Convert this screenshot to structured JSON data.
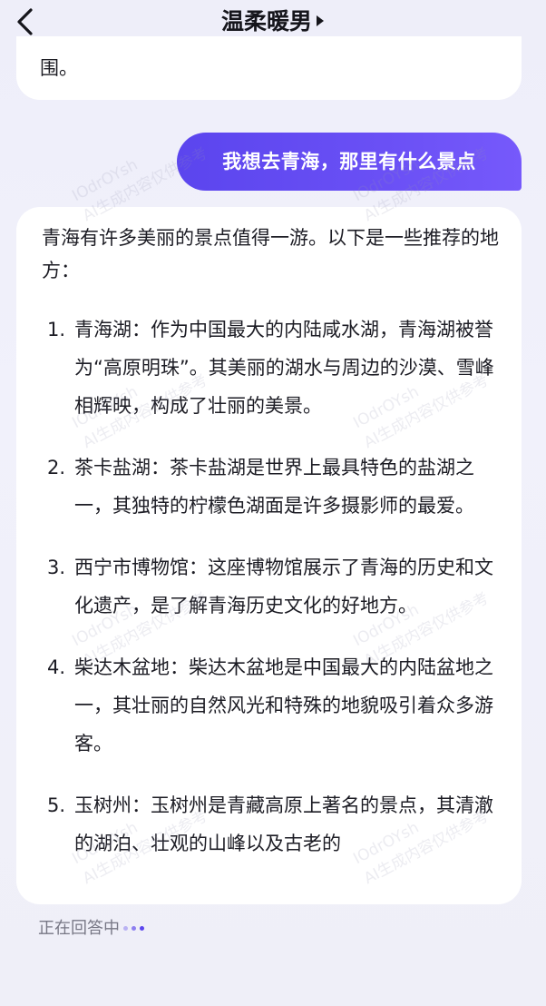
{
  "header": {
    "title": "温柔暖男"
  },
  "messages": {
    "previous_ai_tail": "围。",
    "user_question": "我想去青海，那里有什么景点",
    "ai_answer": {
      "intro": "青海有许多美丽的景点值得一游。以下是一些推荐的地方：",
      "items": [
        {
          "num": "1.",
          "text": "青海湖：作为中国最大的内陆咸水湖，青海湖被誉为“高原明珠”。其美丽的湖水与周边的沙漠、雪峰相辉映，构成了壮丽的美景。"
        },
        {
          "num": "2.",
          "text": "茶卡盐湖：茶卡盐湖是世界上最具特色的盐湖之一，其独特的柠檬色湖面是许多摄影师的最爱。"
        },
        {
          "num": "3.",
          "text": "西宁市博物馆：这座博物馆展示了青海的历史和文化遗产，是了解青海历史文化的好地方。"
        },
        {
          "num": "4.",
          "text": "柴达木盆地：柴达木盆地是中国最大的内陆盆地之一，其壮丽的自然风光和特殊的地貌吸引着众多游客。"
        },
        {
          "num": "5.",
          "text": "玉树州：玉树州是青藏高原上著名的景点，其清澈的湖泊、壮观的山峰以及古老的"
        }
      ]
    }
  },
  "status": {
    "text": "正在回答中"
  },
  "watermark": {
    "line1": "IOdrOYsh",
    "line2": "AI生成内容仅供参考"
  },
  "colors": {
    "accent": "#5b45ee",
    "dots": [
      "#b9b2f3",
      "#8d7ff0",
      "#5b45ee"
    ]
  }
}
